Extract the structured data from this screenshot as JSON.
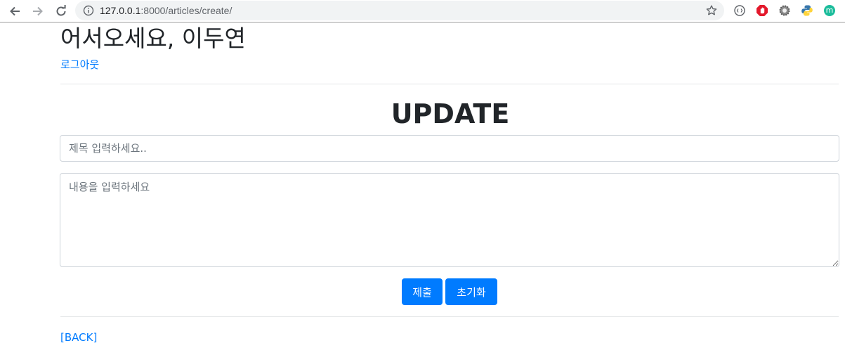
{
  "browser": {
    "url_host": "127.0.0.1",
    "url_rest": ":8000/articles/create/",
    "toolbar_icons": [
      "back-icon",
      "forward-icon",
      "reload-icon",
      "site-info-icon",
      "bookmark-star-icon"
    ],
    "extensions": [
      "reader-extension-icon",
      "adblock-extension-icon",
      "settings-extension-icon",
      "python-extension-icon",
      "profile-m-extension-icon"
    ],
    "profile_letter": "m"
  },
  "header": {
    "greeting": "어서오세요, 이두연",
    "logout_label": "로그아웃"
  },
  "form": {
    "heading": "UPDATE",
    "title_placeholder": "제목 입력하세요..",
    "content_placeholder": "내용을 입력하세요",
    "submit_label": "제출",
    "reset_label": "초기화"
  },
  "footer": {
    "back_label": "[BACK]"
  },
  "colors": {
    "link": "#007bff",
    "primary_button": "#007bff",
    "heading_text": "#212529"
  }
}
